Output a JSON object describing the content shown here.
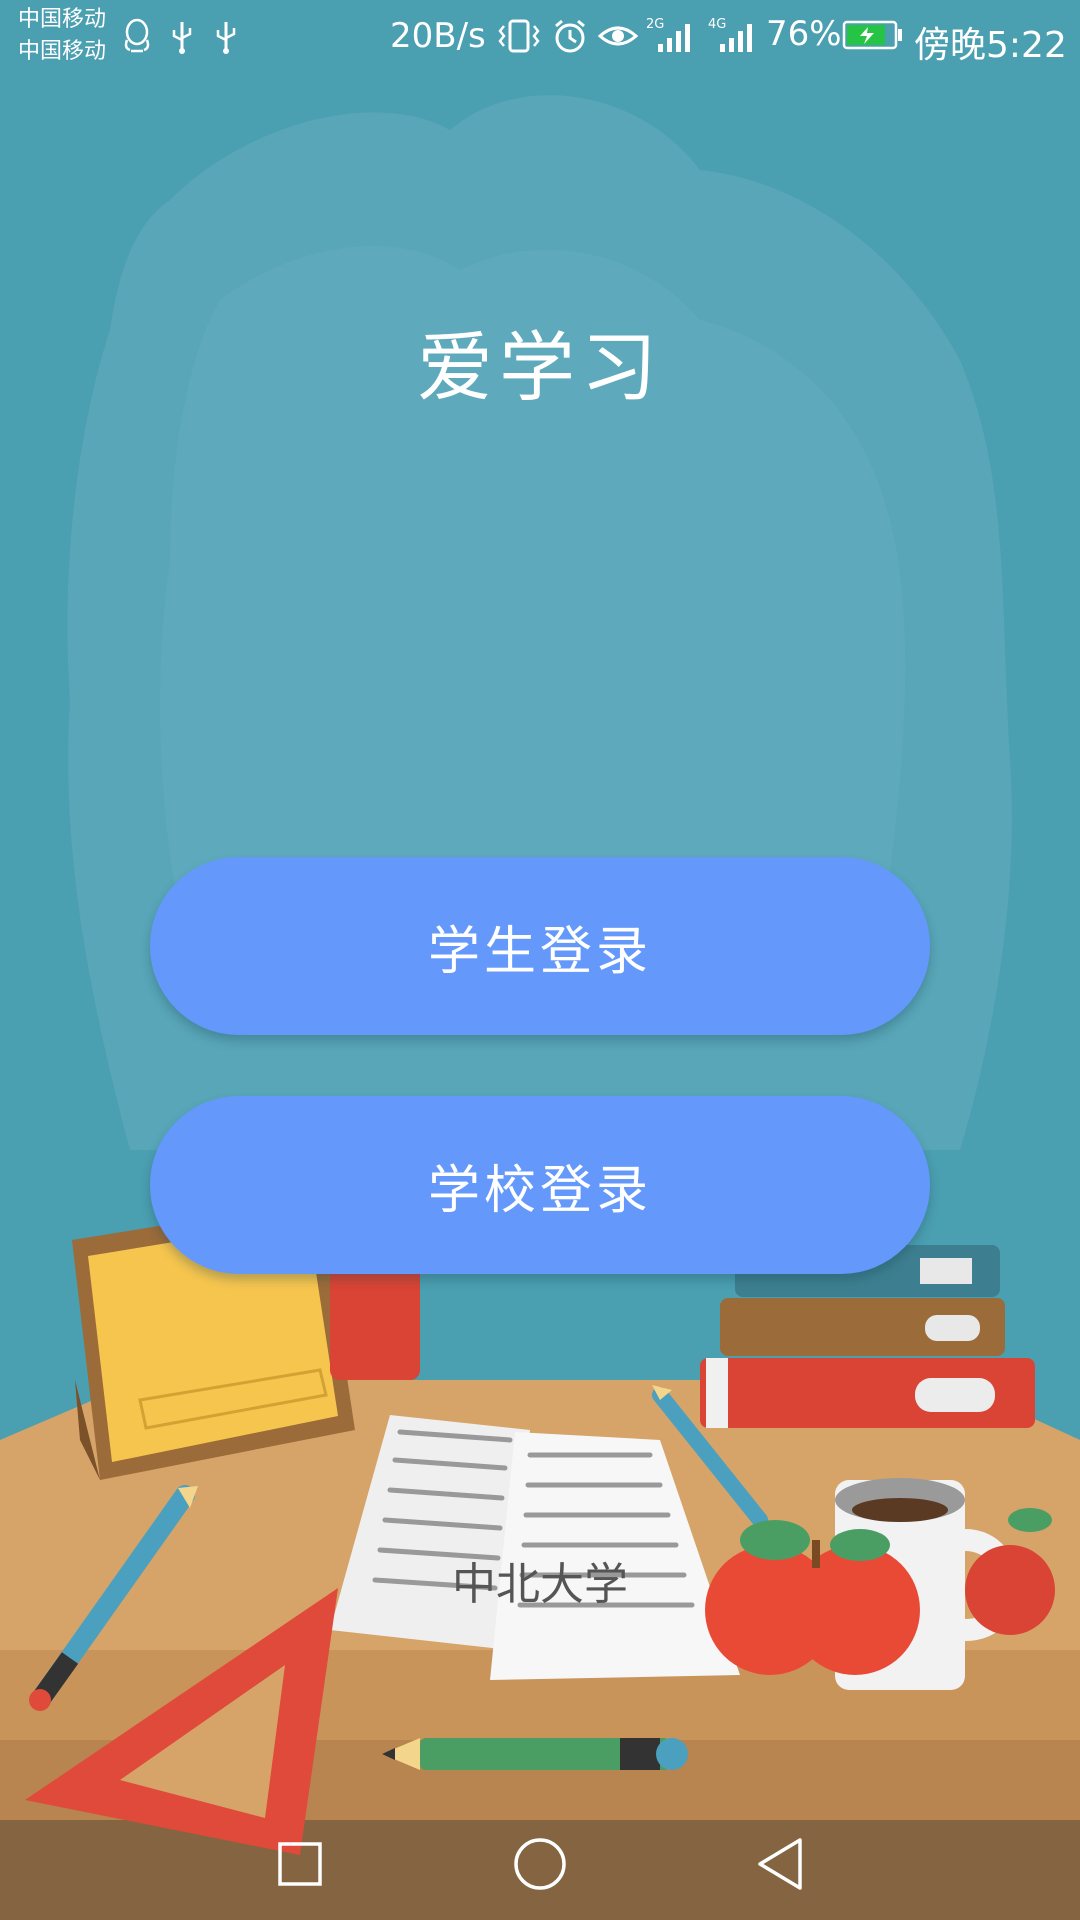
{
  "status_bar": {
    "carrier_1": "中国移动",
    "carrier_2": "中国移动",
    "net_speed": "20B/s",
    "signal_1_label": "2G",
    "signal_2_label": "4G",
    "battery_percent": "76%",
    "time": "傍晚5:22",
    "icons": [
      "qq-icon",
      "usb-icon",
      "usb-icon",
      "vibrate-icon",
      "alarm-icon",
      "eye-comfort-icon",
      "signal-icon",
      "signal-icon",
      "battery-charging-icon"
    ]
  },
  "app": {
    "title": "爱学习",
    "school_name": "中北大学"
  },
  "buttons": {
    "student_login": "学生登录",
    "school_login": "学校登录"
  },
  "nav_bar": {
    "icons": [
      "recents-square-icon",
      "home-circle-icon",
      "back-triangle-icon"
    ]
  },
  "colors": {
    "background": "#4a9fb1",
    "button": "#6499fb",
    "table": "#d7a46a"
  }
}
